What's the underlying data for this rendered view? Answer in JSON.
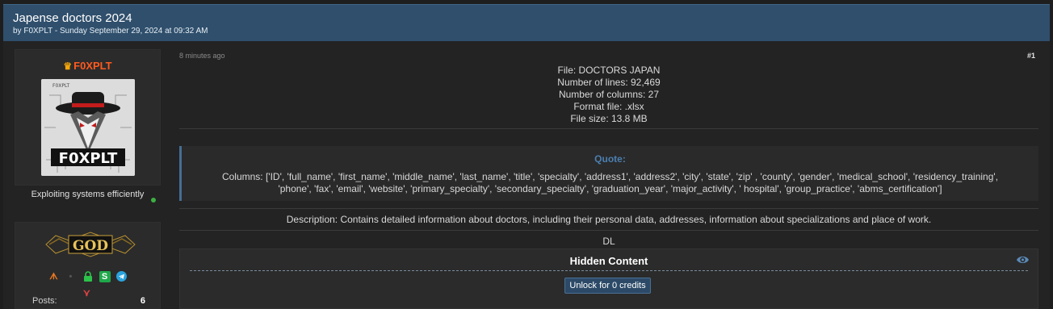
{
  "thread": {
    "title": "Japense doctors 2024",
    "meta": "by F0XPLT - Sunday September 29, 2024 at 09:32 AM"
  },
  "user": {
    "name": "F0XPLT",
    "avatar_text": "F0XPLT",
    "avatar_small": "F0XPLT",
    "tagline": "Exploiting systems efficiently",
    "rank": "GOD",
    "stats": [
      {
        "label": "Posts:",
        "value": "6"
      }
    ],
    "online_color": "#3cb043"
  },
  "post": {
    "time_ago": "8 minutes ago",
    "number": "#1",
    "file_info": [
      "File: DOCTORS JAPAN",
      "Number of lines: 92,469",
      "Number of columns: 27",
      "Format file: .xlsx",
      "File size: 13.8 MB"
    ],
    "quote_title": "Quote:",
    "quote_lines": [
      "Columns: ['ID', 'full_name', 'first_name', 'middle_name', 'last_name', 'title', 'specialty', 'address1', 'address2', 'city', 'state', 'zip' , 'county', 'gender', 'medical_school', 'residency_training',",
      "'phone', 'fax', 'email', 'website', 'primary_specialty', 'secondary_specialty', 'graduation_year', 'major_activity', ' hospital', 'group_practice', 'abms_certification']"
    ],
    "description": "Description: Contains detailed information about doctors, including their personal data, addresses, information about specializations and place of work.",
    "dl": "DL",
    "hidden_title": "Hidden Content",
    "unlock_label": "Unlock for 0 credits"
  },
  "colors": {
    "header_bg": "#2f4f6c",
    "username": "#ff5a1f",
    "quote_accent": "#4b7fb0",
    "button_bg": "#2c4a68"
  },
  "icons": [
    "crown-icon",
    "eye-icon",
    "online-status-icon"
  ]
}
